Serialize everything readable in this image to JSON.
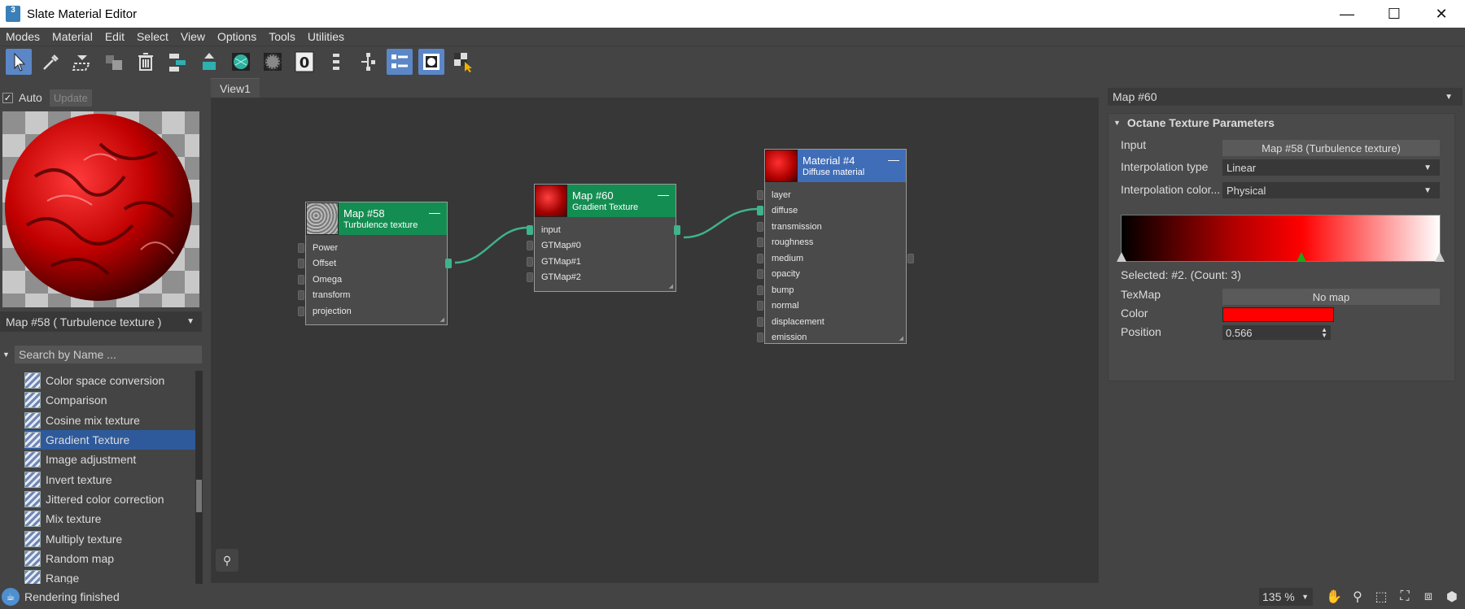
{
  "window": {
    "app_icon_label": "3",
    "title": "Slate Material Editor",
    "minimize": "—",
    "maximize": "☐",
    "close": "✕"
  },
  "menu": [
    "Modes",
    "Material",
    "Edit",
    "Select",
    "View",
    "Options",
    "Tools",
    "Utilities"
  ],
  "toolbar": {
    "icons": [
      "select-arrow-icon",
      "eyedropper-icon",
      "assign-material-icon",
      "delete-material-icon",
      "trash-icon",
      "layout-tree-icon",
      "move-children-icon",
      "show-map-icon",
      "background-checker-icon",
      "material-id-icon",
      "layout-all-icon",
      "layout-children-icon",
      "parameter-editor-icon",
      "navigator-icon",
      "hide-unused-icon"
    ],
    "material_id": "0"
  },
  "left_panel": {
    "auto_label": "Auto",
    "auto_checked": "✓",
    "update_label": "Update",
    "map_select": "Map #58  ( Turbulence texture )",
    "search_placeholder": "Search by Name ...",
    "textures": [
      "Color space conversion",
      "Comparison",
      "Cosine mix texture",
      "Gradient Texture",
      "Image adjustment",
      "Invert texture",
      "Jittered color correction",
      "Mix texture",
      "Multiply texture",
      "Random map",
      "Range"
    ],
    "selected_texture": "Gradient Texture"
  },
  "view": {
    "tab": "View1"
  },
  "nodes": {
    "map58": {
      "title": "Map #58",
      "subtitle": "Turbulence texture",
      "ports": [
        "Power",
        "Offset",
        "Omega",
        "transform",
        "projection"
      ]
    },
    "map60": {
      "title": "Map #60",
      "subtitle": "Gradient Texture",
      "ports": [
        "input",
        "GTMap#0",
        "GTMap#1",
        "GTMap#2"
      ]
    },
    "material4": {
      "title": "Material #4",
      "subtitle": "Diffuse material",
      "ports": [
        "layer",
        "diffuse",
        "transmission",
        "roughness",
        "medium",
        "opacity",
        "bump",
        "normal",
        "displacement",
        "emission"
      ]
    }
  },
  "right_panel": {
    "header": "Map #60",
    "rollout_title": "Octane Texture Parameters",
    "input_label": "Input",
    "input_value": "Map #58 (Turbulence texture)",
    "interp_type_label": "Interpolation type",
    "interp_type_value": "Linear",
    "interp_color_label": "Interpolation color...",
    "interp_color_value": "Physical",
    "selected_text": "Selected: #2. (Count: 3)",
    "texmap_label": "TexMap",
    "texmap_value": "No map",
    "color_label": "Color",
    "color_value": "#ff0000",
    "position_label": "Position",
    "position_value": "0.566",
    "gradient_stop_positions": [
      0.0,
      0.566,
      1.0
    ]
  },
  "status": {
    "text": "Rendering finished",
    "zoom": "135 %"
  },
  "colors": {
    "node_green": "#148d52",
    "node_blue": "#3f6db8",
    "wire": "#3fb38a",
    "selection": "#2e5a9b"
  }
}
